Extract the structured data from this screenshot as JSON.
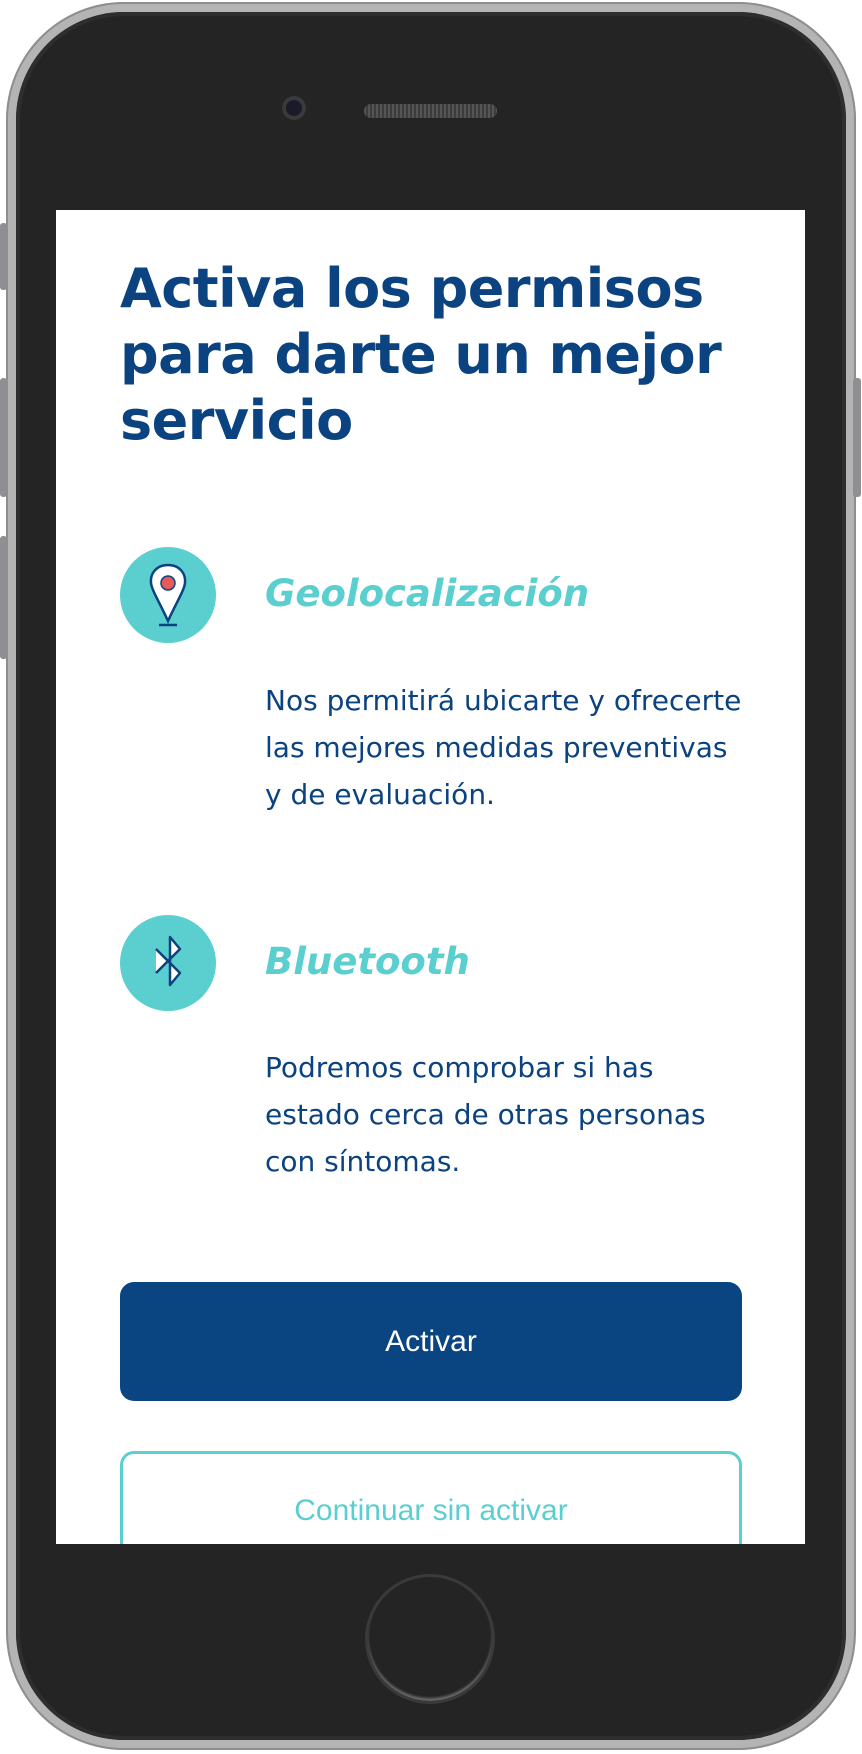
{
  "screen": {
    "title": "Activa los permisos para darte un mejor servicio",
    "permissions": [
      {
        "icon": "location-pin-icon",
        "title": "Geolocalización",
        "description": "Nos permitirá ubicarte y ofrecerte las mejores medidas preventivas y de evaluación."
      },
      {
        "icon": "bluetooth-icon",
        "title": "Bluetooth",
        "description": "Podremos comprobar si has estado cerca de otras personas con síntomas."
      }
    ],
    "activate_label": "Activar",
    "skip_label": "Continuar sin activar"
  },
  "colors": {
    "primary": "#0a4582",
    "accent": "#5bcfcf",
    "pin_dot": "#e85a5a"
  }
}
